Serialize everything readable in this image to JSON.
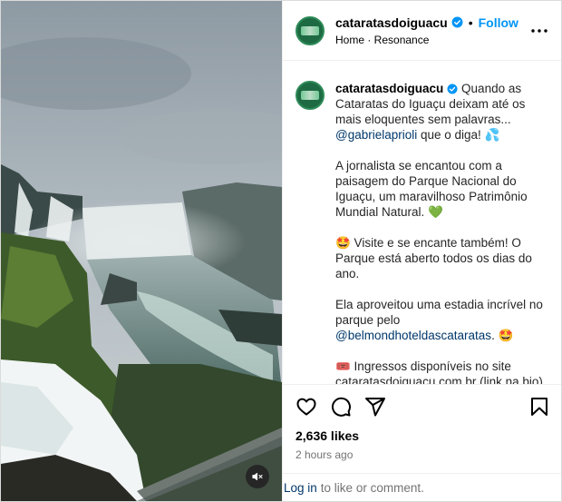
{
  "colors": {
    "accent": "#0095f6",
    "link": "#00376b",
    "muted": "#737373",
    "verified": "#0095f6"
  },
  "media": {
    "alt_icon": "waterfall-photo",
    "mute_icon": "speaker-muted-icon"
  },
  "header": {
    "username": "cataratasdoiguacu",
    "separator": "•",
    "follow_label": "Follow",
    "audio": "Home · Resonance",
    "more_icon": "more-horizontal-icon"
  },
  "caption": {
    "username": "cataratasdoiguacu",
    "text1": " Quando as Cataratas do Iguaçu deixam até os mais eloquentes sem palavras...\n",
    "mention1": "@gabrielaprioli",
    "text2": " que o diga! 💦\n\nA jornalista se encantou com a paisagem do Parque Nacional do Iguaçu, um maravilhoso Patrimônio Mundial Natural. 💚\n\n🤩 Visite e se encante também! O Parque está aberto todos os dias do ano.\n\nEla aproveitou uma estadia incrível no parque pelo\n",
    "mention2": "@belmondhoteldascataratas",
    "text3": ". 🤩\n\n🎟️ Ingressos disponíveis no site cataratasdoiguacu.com.br (link na bio)."
  },
  "actions": {
    "like_icon": "heart-icon",
    "comment_icon": "comment-icon",
    "share_icon": "share-icon",
    "save_icon": "bookmark-icon"
  },
  "likes": "2,636 likes",
  "time": "2 hours ago",
  "login": {
    "link": "Log in",
    "rest": "to like or comment."
  }
}
